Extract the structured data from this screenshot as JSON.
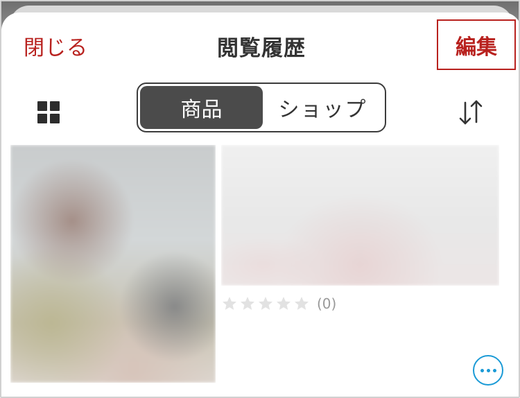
{
  "header": {
    "close_label": "閉じる",
    "title": "閲覧履歴",
    "edit_label": "編集"
  },
  "segments": {
    "items": [
      {
        "label": "商品",
        "selected": true
      },
      {
        "label": "ショップ",
        "selected": false
      }
    ]
  },
  "icons": {
    "grid": "grid-view-icon",
    "sort": "sort-icon",
    "more": "more-options-icon",
    "star": "star-icon"
  },
  "products": [
    {
      "image": "blurred-product-image"
    },
    {
      "image": "blurred-product-image",
      "rating": {
        "stars_filled": 0,
        "stars_total": 5,
        "count_label": "(0)"
      }
    }
  ],
  "colors": {
    "accent_red": "#b8211e",
    "segment_active": "#4b4b4b",
    "more_blue": "#1a9ad6",
    "star_empty": "#e2e2e2"
  }
}
